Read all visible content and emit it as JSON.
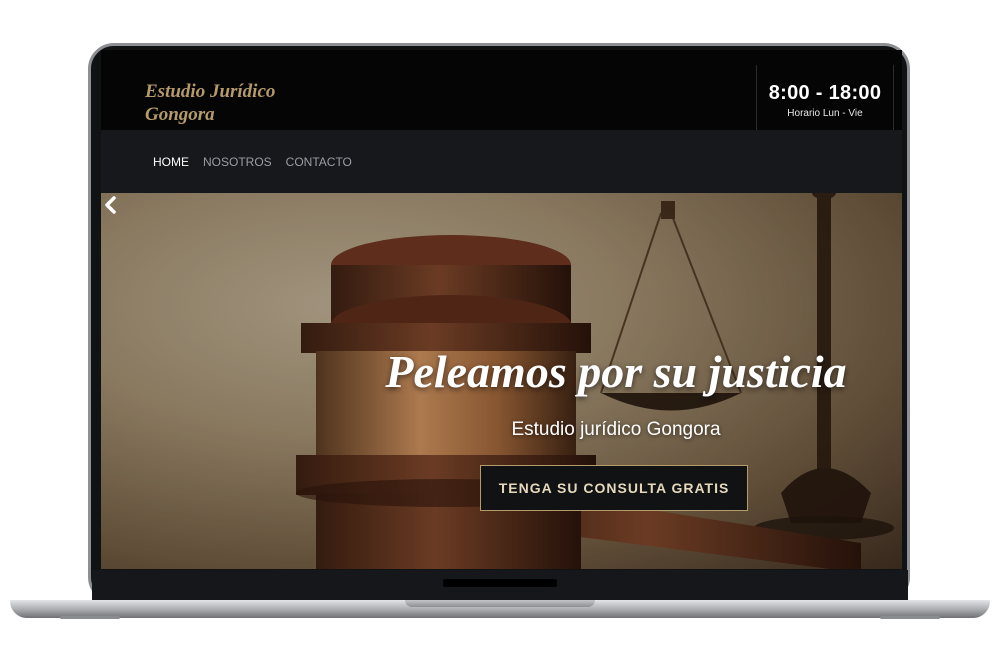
{
  "header": {
    "brand_line1": "Estudio Jurídico",
    "brand_line2": "Gongora",
    "hours_time": "8:00 - 18:00",
    "hours_label": "Horario Lun - Vie"
  },
  "nav": {
    "items": [
      {
        "label": "HOME",
        "active": true
      },
      {
        "label": "NOSOTROS",
        "active": false
      },
      {
        "label": "CONTACTO",
        "active": false
      }
    ]
  },
  "hero": {
    "title": "Peleamos por su justicia",
    "subtitle": "Estudio jurídico Gongora",
    "cta_label": "TENGA SU CONSULTA GRATIS",
    "prev_icon": "chevron-left-icon",
    "image": "gavel-and-scales-icon"
  },
  "colors": {
    "accent": "#b59a6a",
    "topbar": "#050505",
    "navbar": "#16181b"
  }
}
